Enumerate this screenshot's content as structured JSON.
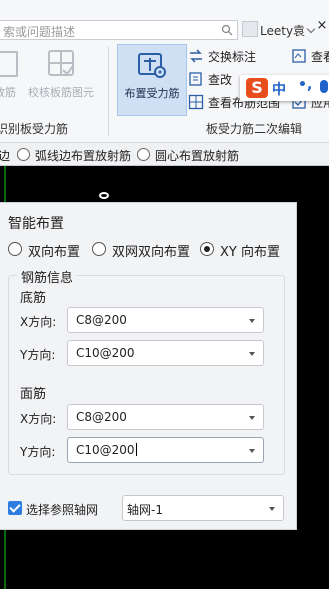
{
  "ribbon": {
    "search_placeholder": "索或问题描述",
    "user_name": "Leety袁",
    "buttons": {
      "place_rebar_faded": "放筋",
      "check_rebar_drawing": "校核板筋图元",
      "place_stress_rebar": "布置受力筋"
    },
    "small_buttons": {
      "swap_label": "交换标注",
      "view_rebar": "查改",
      "view_rebar_range": "查看布筋范围",
      "view_right_1": "查看",
      "view_right_2": "应用"
    },
    "group_labels": {
      "left": "识别板受力筋",
      "right": "板受力筋二次编辑"
    },
    "ime": {
      "s": "S",
      "zh": "中",
      "punct": "•,"
    }
  },
  "option_bar": {
    "opt1": "边",
    "opt2": "弧线边布置放射筋",
    "opt3": "圆心布置放射筋"
  },
  "dialog": {
    "title": "智能布置",
    "modes": [
      {
        "label": "双向布置",
        "selected": false
      },
      {
        "label": "双网双向布置",
        "selected": false
      },
      {
        "label": "XY 向布置",
        "selected": true
      }
    ],
    "rebar_info_legend": "钢筋信息",
    "bottom": {
      "heading": "底筋",
      "x_label": "X方向:",
      "x_value": "C8@200",
      "y_label": "Y方向:",
      "y_value": "C10@200"
    },
    "top": {
      "heading": "面筋",
      "x_label": "X方向:",
      "x_value": "C8@200",
      "y_label": "Y方向:",
      "y_value": "C10@200"
    },
    "axis_checkbox_label": "选择参照轴网",
    "axis_checked": true,
    "axis_value": "轴网-1"
  },
  "colors": {
    "accent": "#2f7de1",
    "canvas": "#000000",
    "grid_line": "#0b6a0b",
    "active_button": "#cfe0f5"
  }
}
